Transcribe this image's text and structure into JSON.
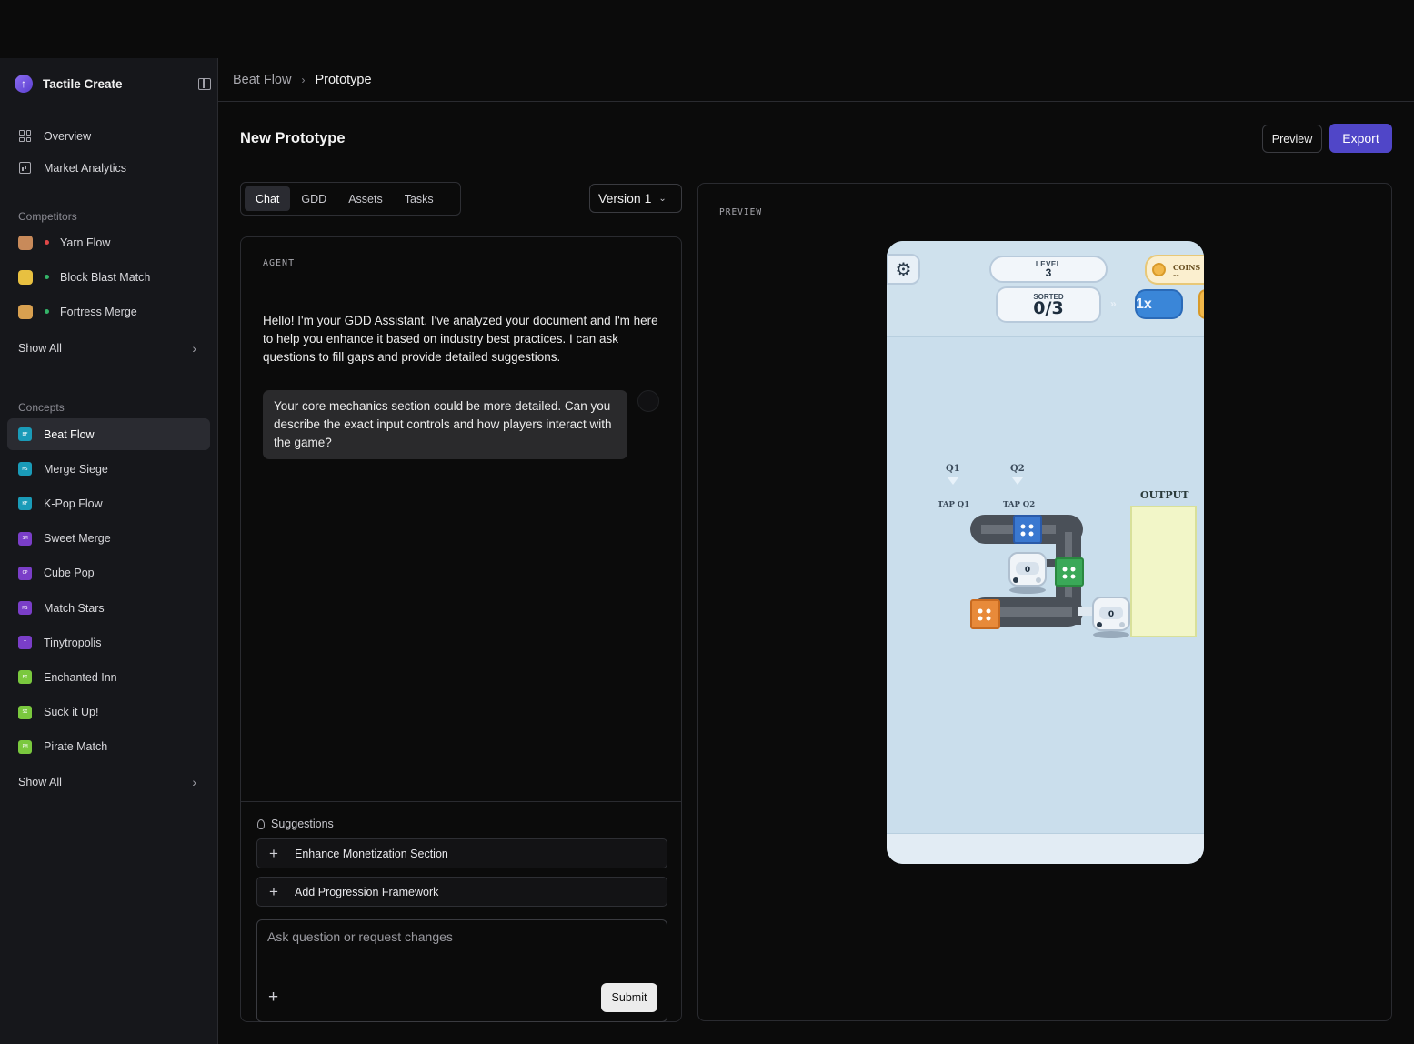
{
  "sidebar": {
    "brand": "Tactile Create",
    "nav": [
      {
        "label": "Overview",
        "icon": "grid-icon"
      },
      {
        "label": "Market Analytics",
        "icon": "chart-icon"
      }
    ],
    "competitors_label": "Competitors",
    "competitors": [
      {
        "label": "Yarn Flow",
        "status_color": "#e04848",
        "avatar_color": "#c88a5a"
      },
      {
        "label": "Block Blast Match",
        "status_color": "#34b368",
        "avatar_color": "#e8c040"
      },
      {
        "label": "Fortress Merge",
        "status_color": "#34b368",
        "avatar_color": "#d8a050"
      }
    ],
    "competitors_show_all": "Show All",
    "concepts_label": "Concepts",
    "concepts": [
      {
        "label": "Beat Flow",
        "abbr": "BF",
        "color": "#1a9bb8",
        "active": true
      },
      {
        "label": "Merge Siege",
        "abbr": "MS",
        "color": "#1a9bb8"
      },
      {
        "label": "K-Pop Flow",
        "abbr": "KF",
        "color": "#1a9bb8"
      },
      {
        "label": "Sweet Merge",
        "abbr": "SM",
        "color": "#7a3ec8"
      },
      {
        "label": "Cube Pop",
        "abbr": "CP",
        "color": "#7a3ec8"
      },
      {
        "label": "Match Stars",
        "abbr": "MS",
        "color": "#7a3ec8"
      },
      {
        "label": "Tinytropolis",
        "abbr": "T",
        "color": "#7a3ec8"
      },
      {
        "label": "Enchanted Inn",
        "abbr": "EI",
        "color": "#7ac83e"
      },
      {
        "label": "Suck it Up!",
        "abbr": "SI",
        "color": "#7ac83e"
      },
      {
        "label": "Pirate Match",
        "abbr": "PM",
        "color": "#7ac83e"
      }
    ],
    "concepts_show_all": "Show All"
  },
  "breadcrumb": {
    "parent": "Beat Flow",
    "current": "Prototype"
  },
  "header": {
    "title": "New Prototype",
    "preview_label": "Preview",
    "export_label": "Export",
    "accent": "#5046c8"
  },
  "tabs": [
    {
      "label": "Chat",
      "active": true
    },
    {
      "label": "GDD"
    },
    {
      "label": "Assets"
    },
    {
      "label": "Tasks"
    }
  ],
  "version": {
    "selected": "Version 1"
  },
  "chat": {
    "agent_label": "AGENT",
    "agent_message": "Hello! I'm your GDD Assistant. I've analyzed your document and I'm here to help you enhance it based on industry best practices. I can ask questions to fill gaps and provide detailed suggestions.",
    "user_message": "Your core mechanics section could be more detailed. Can you describe the exact input controls and how players interact with the game?",
    "suggestions_label": "Suggestions",
    "suggestions": [
      "Enhance Monetization Section",
      "Add Progression Framework"
    ],
    "input_placeholder": "Ask question or request changes",
    "submit_label": "Submit"
  },
  "preview": {
    "label": "PREVIEW",
    "game": {
      "level_label": "LEVEL",
      "level_value": "3",
      "coins_label": "COINS",
      "coins_value": "--",
      "sorted_label": "SORTED",
      "sorted_value": "0/3",
      "speed": "1x",
      "ffwd": "»",
      "q1": "Q1",
      "q2": "Q2",
      "tap_q1": "TAP Q1",
      "tap_q2": "TAP Q2",
      "output_label": "OUTPUT",
      "robot_1": "0",
      "robot_2": "0"
    }
  }
}
